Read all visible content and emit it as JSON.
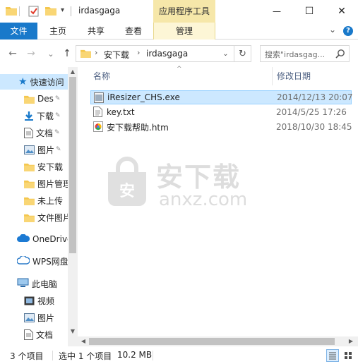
{
  "window": {
    "title": "irdasgaga",
    "context_tab_group": "应用程序工具",
    "minimize_glyph": "—",
    "maximize_glyph": "☐",
    "close_glyph": "✕"
  },
  "ribbon": {
    "tabs": [
      "文件",
      "主页",
      "共享",
      "查看",
      "管理"
    ],
    "expand_glyph": "⌄",
    "help_glyph": "?"
  },
  "address": {
    "back_glyph": "←",
    "forward_glyph": "→",
    "recent_glyph": "⌄",
    "up_glyph": "↑",
    "segments": [
      "安下载",
      "irdasgaga"
    ],
    "separator": "›",
    "dropdown_glyph": "⌄",
    "refresh_glyph": "↻"
  },
  "search": {
    "placeholder": "搜索\"irdasgag...",
    "icon": "search-icon"
  },
  "navpane": {
    "quick_access": "快速访问",
    "pinned": [
      {
        "label": "Des",
        "icon": "desktop-folder-icon",
        "pinned": true
      },
      {
        "label": "下载",
        "icon": "download-arrow-icon",
        "pinned": true
      },
      {
        "label": "文档",
        "icon": "document-icon",
        "pinned": true
      },
      {
        "label": "图片",
        "icon": "pictures-icon",
        "pinned": true
      },
      {
        "label": "安下载",
        "icon": "folder-icon",
        "pinned": false
      },
      {
        "label": "图片管理",
        "icon": "folder-icon",
        "pinned": false
      },
      {
        "label": "未上传",
        "icon": "folder-icon",
        "pinned": false
      },
      {
        "label": "文件图片",
        "icon": "folder-icon",
        "pinned": false
      }
    ],
    "onedrive": "OneDrive",
    "wps": "WPS网盘",
    "this_pc": "此电脑",
    "pc_items": [
      {
        "label": "视频",
        "icon": "video-icon"
      },
      {
        "label": "图片",
        "icon": "pictures-icon"
      },
      {
        "label": "文档",
        "icon": "document-icon"
      }
    ],
    "pin_glyph": "📌"
  },
  "filelist": {
    "columns": {
      "name": "名称",
      "date": "修改日期"
    },
    "sort_glyph": "^",
    "rows": [
      {
        "name": "iResizer_CHS.exe",
        "date": "2014/12/13 20:07",
        "icon": "exe-icon",
        "selected": true
      },
      {
        "name": "key.txt",
        "date": "2014/5/25 17:26",
        "icon": "text-file-icon",
        "selected": false
      },
      {
        "name": "安下载帮助.htm",
        "date": "2018/10/30 18:45",
        "icon": "htm-file-icon",
        "selected": false
      }
    ]
  },
  "watermark": {
    "title": "安下载",
    "domain": "anxz.com",
    "badge_char": "安"
  },
  "status": {
    "item_count": "3 个项目",
    "selected": "选中 1 个项目",
    "size": "10.2 MB"
  },
  "colors": {
    "accent": "#1979ca",
    "selection": "#cce8ff",
    "context_tab": "#f6e7a9",
    "folder": "#f4c74e"
  }
}
